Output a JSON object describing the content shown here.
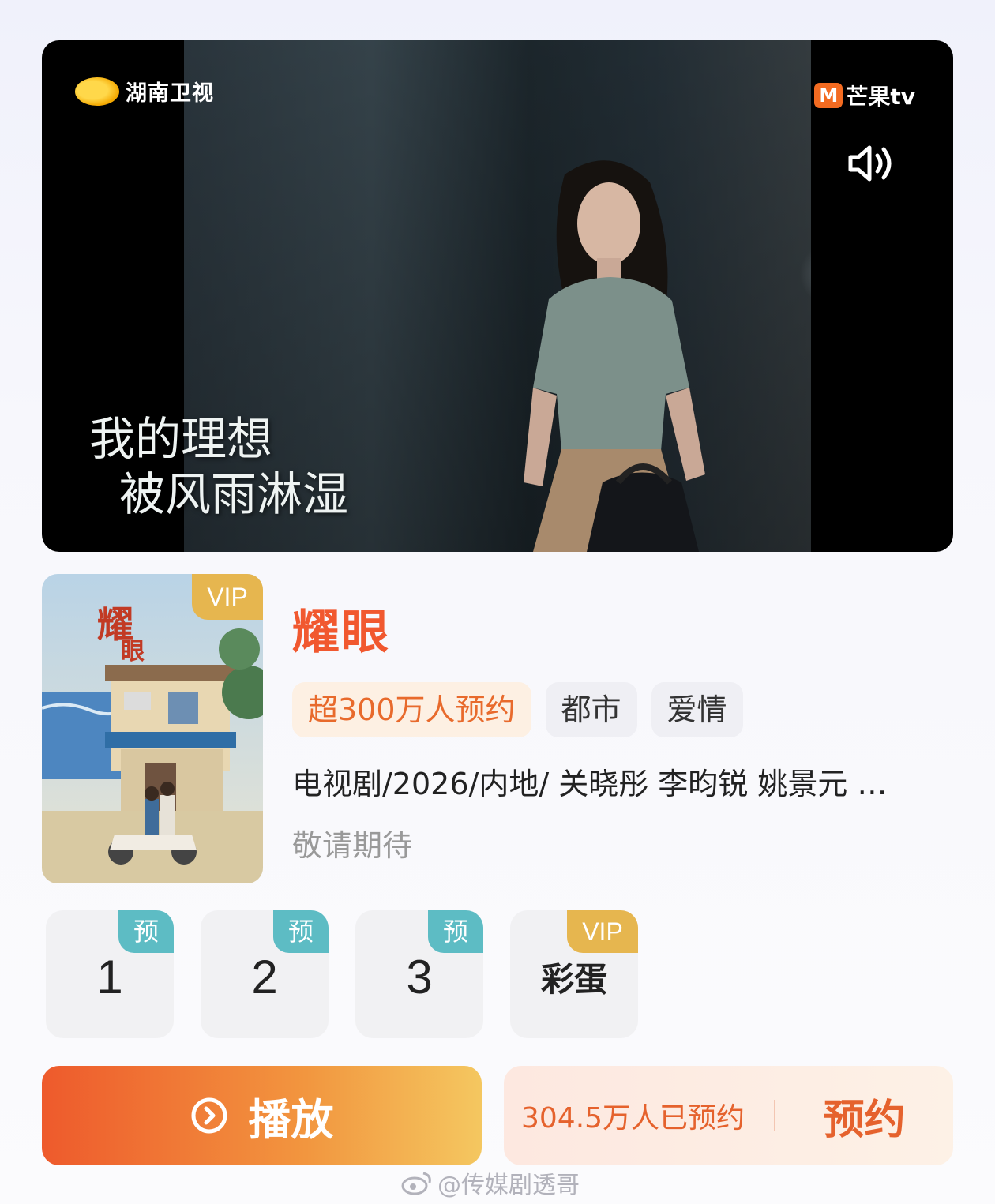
{
  "player": {
    "channel_logo": "湖南卫视",
    "platform_logo": "芒果tv",
    "subtitle_line1": "我的理想",
    "subtitle_line2": "被风雨淋湿",
    "mute_icon": "speaker-muted-icon"
  },
  "show": {
    "poster_vip": "VIP",
    "title": "耀眼",
    "tags": [
      "超300万人预约",
      "都市",
      "爱情"
    ],
    "meta": "电视剧/2026/内地/ 关晓彤 李昀锐 姚景元 …",
    "status": "敬请期待"
  },
  "episodes": [
    {
      "label": "1",
      "badge": "预"
    },
    {
      "label": "2",
      "badge": "预"
    },
    {
      "label": "3",
      "badge": "预"
    },
    {
      "label": "彩蛋",
      "badge": "VIP"
    }
  ],
  "actions": {
    "play_label": "播放",
    "reserve_count": "304.5万人已预约",
    "reserve_label": "预约"
  },
  "watermark": "@传媒剧透哥",
  "colors": {
    "accent": "#f1582f",
    "vip_gold": "#e6b64f",
    "preview_teal": "#5dbcc4"
  }
}
